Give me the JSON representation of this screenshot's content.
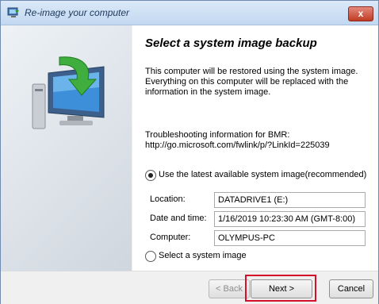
{
  "window": {
    "title": "Re-image your computer",
    "close_label": "x"
  },
  "content": {
    "heading": "Select a system image backup",
    "description": "This computer will be restored using the system image. Everything on this computer will be replaced with the information in the system image.",
    "troubleshooting_label": "Troubleshooting information for BMR:",
    "troubleshooting_link": "http://go.microsoft.com/fwlink/p/?LinkId=225039"
  },
  "options": {
    "latest": {
      "label": "Use the latest available system image(recommended)",
      "selected": true
    },
    "select": {
      "label": "Select a system image",
      "selected": false
    }
  },
  "fields": {
    "location": {
      "label": "Location:",
      "value": "DATADRIVE1 (E:)"
    },
    "datetime": {
      "label": "Date and time:",
      "value": "1/16/2019 10:23:30 AM (GMT-8:00)"
    },
    "computer": {
      "label": "Computer:",
      "value": "OLYMPUS-PC"
    }
  },
  "buttons": {
    "back": "< Back",
    "next": "Next >",
    "cancel": "Cancel"
  },
  "icons": {
    "app": "restore-computer-icon",
    "hero": "computer-restore-graphic"
  }
}
